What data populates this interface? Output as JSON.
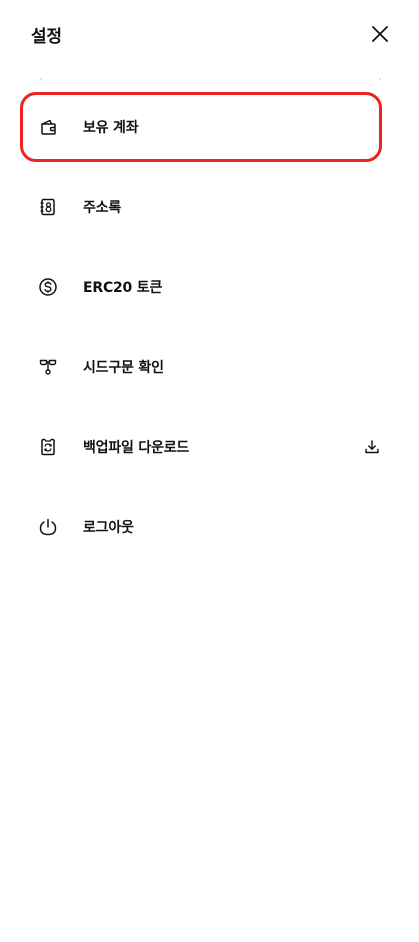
{
  "header": {
    "title": "설정",
    "close_icon": "close-icon"
  },
  "menu": {
    "items": [
      {
        "label": "보유 계좌",
        "icon": "wallet-icon",
        "selected": true
      },
      {
        "label": "주소록",
        "icon": "address-book-icon",
        "selected": false
      },
      {
        "label": "ERC20 토큰",
        "icon": "dollar-coin-icon",
        "selected": false
      },
      {
        "label": "시드구문 확인",
        "icon": "seed-sprout-icon",
        "selected": false
      },
      {
        "label": "백업파일 다운로드",
        "icon": "phone-sync-icon",
        "selected": false,
        "trailing_icon": "download-icon"
      },
      {
        "label": "로그아웃",
        "icon": "power-icon",
        "selected": false
      }
    ]
  },
  "colors": {
    "highlight_border": "#ee2222",
    "text": "#111111"
  }
}
